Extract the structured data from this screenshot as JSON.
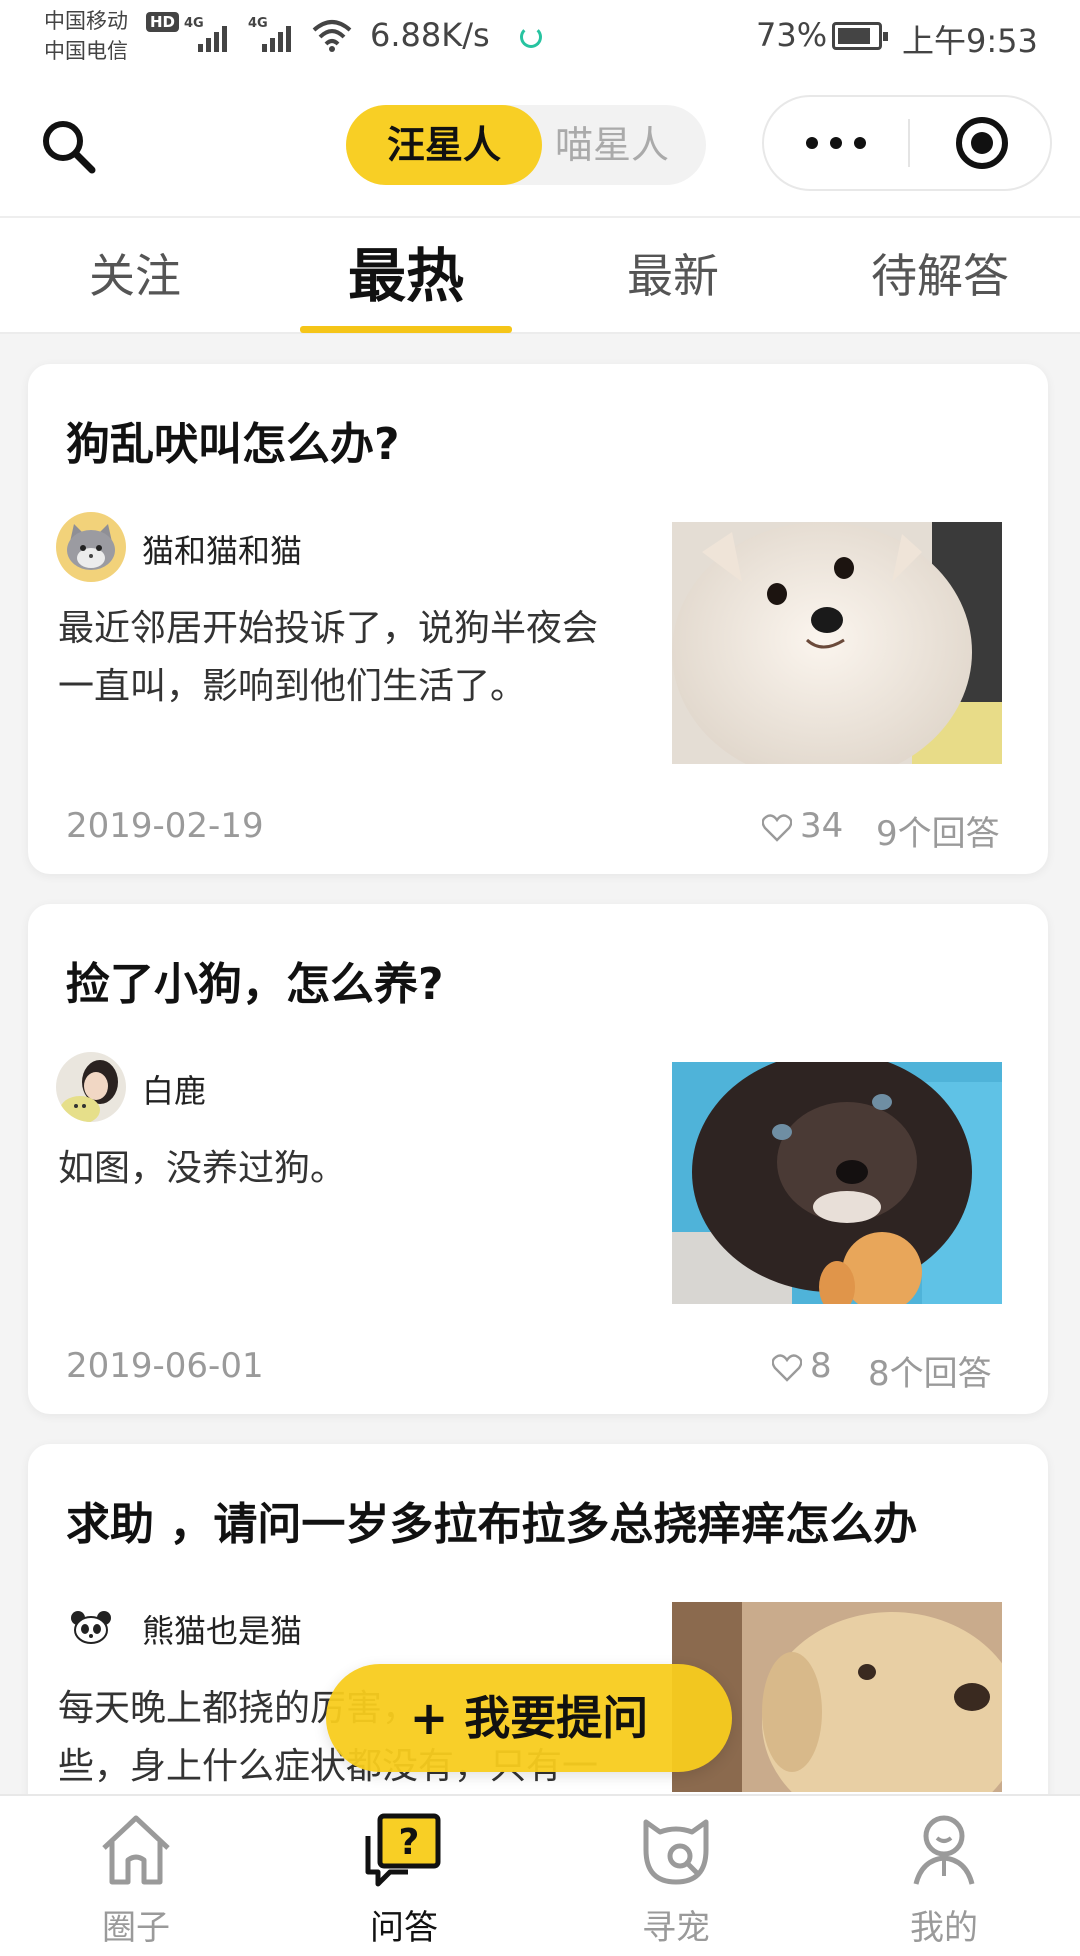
{
  "status_bar": {
    "carrier1": "中国移动",
    "hd_badge": "HD",
    "carrier2": "中国电信",
    "network1": "4G",
    "network2": "4G",
    "net_speed": "6.88K/s",
    "battery_pct": "73%",
    "time": "上午9:53"
  },
  "header": {
    "pet_toggle": {
      "active": "汪星人",
      "inactive": "喵星人"
    }
  },
  "tabs": [
    {
      "label": "关注"
    },
    {
      "label": "最热"
    },
    {
      "label": "最新"
    },
    {
      "label": "待解答"
    }
  ],
  "active_tab": "最热",
  "colors": {
    "accent": "#f8cf25",
    "text": "#111111",
    "muted": "#9a9a9a",
    "background": "#f4f4f4"
  },
  "questions": [
    {
      "title": "狗乱吠叫怎么办?",
      "author": "猫和猫和猫",
      "avatar_icon": "cat-avatar-icon",
      "excerpt_line1": "最近邻居开始投诉了，说狗半夜会",
      "excerpt_line2": "一直叫，影响到他们生活了。",
      "date": "2019-02-19",
      "likes": "34",
      "answers": "9个回答",
      "photo_icon": "white-puppy-photo"
    },
    {
      "title": "捡了小狗，怎么养?",
      "author": "白鹿",
      "avatar_icon": "girl-avatar-icon",
      "excerpt_line1": "如图，没养过狗。",
      "date": "2019-06-01",
      "likes": "8",
      "answers": "8个回答",
      "photo_icon": "dark-puppy-photo"
    },
    {
      "title": "求助 ，请问一岁多拉布拉多总挠痒痒怎么办",
      "author": "熊猫也是猫",
      "avatar_icon": "panda-avatar-icon",
      "excerpt_line1": "每天晚上都挠的厉害，",
      "excerpt_line2": "些，身上什么症状都没有，只有一",
      "photo_icon": "labrador-photo"
    }
  ],
  "ask_button": {
    "label": "+ 我要提问"
  },
  "bottom_nav": [
    {
      "label": "圈子",
      "icon": "home-icon"
    },
    {
      "label": "问答",
      "icon": "qa-icon"
    },
    {
      "label": "寻宠",
      "icon": "find-pet-icon"
    },
    {
      "label": "我的",
      "icon": "profile-icon"
    }
  ]
}
